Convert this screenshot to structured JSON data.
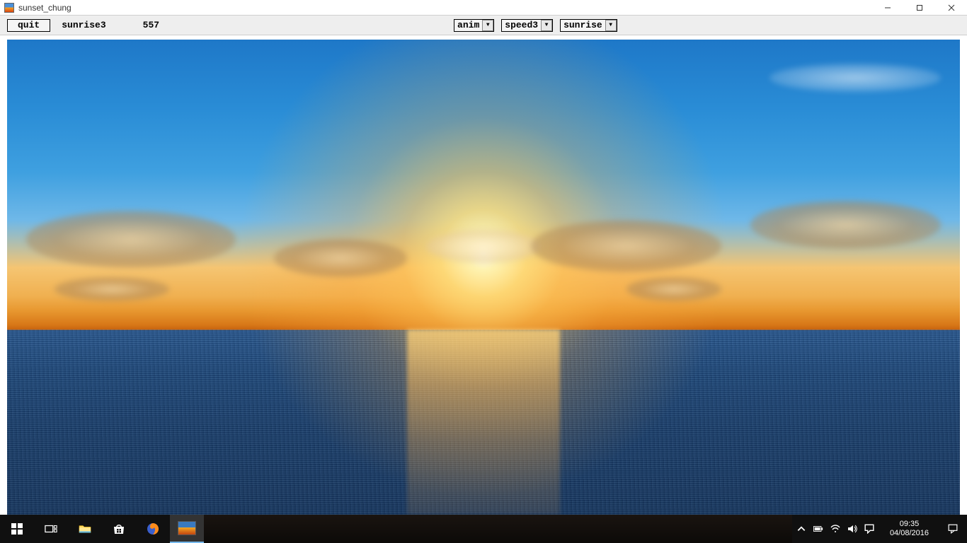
{
  "window": {
    "title": "sunset_chung"
  },
  "toolbar": {
    "quit_label": "quit",
    "mode_label": "sunrise3",
    "frame_label": "557",
    "dd_anim": "anim",
    "dd_speed": "speed3",
    "dd_preset": "sunrise"
  },
  "taskbar": {
    "time": "09:35",
    "date": "04/08/2016"
  }
}
